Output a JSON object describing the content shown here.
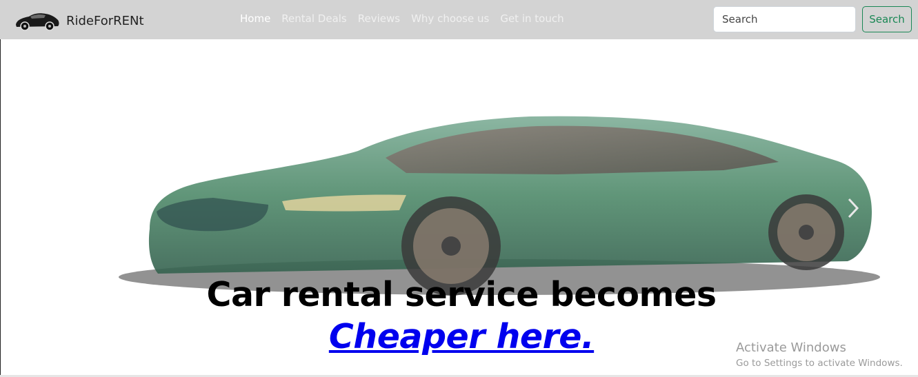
{
  "brand": {
    "name": "RideForRENt",
    "logo_icon": "sports-car-icon"
  },
  "nav": {
    "items": [
      {
        "label": "Home",
        "active": true
      },
      {
        "label": "Rental Deals",
        "active": false
      },
      {
        "label": "Reviews",
        "active": false
      },
      {
        "label": "Why choose us",
        "active": false
      },
      {
        "label": "Get in touch",
        "active": false
      }
    ]
  },
  "search": {
    "placeholder": "Search",
    "value": "",
    "button_label": "Search"
  },
  "hero": {
    "headline_text": "Car rental service becomes ",
    "headline_link": "Cheaper here.",
    "next_icon": "chevron-right-icon"
  },
  "watermark": {
    "title": "Activate Windows",
    "subtitle": "Go to Settings to activate Windows."
  },
  "colors": {
    "navbar_bg": "#d3d3d3",
    "search_button": "#198754",
    "link": "#0000ee",
    "car_body": "#4f8a6a"
  }
}
